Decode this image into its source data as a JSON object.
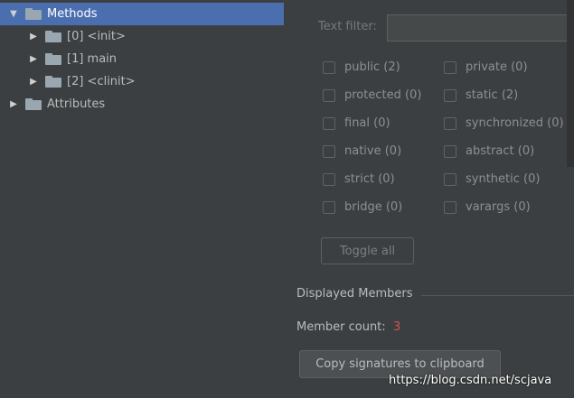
{
  "tree": {
    "items": [
      {
        "label": "Methods",
        "expanded": true,
        "selected": true,
        "level": 0
      },
      {
        "label": "[0] <init>",
        "expanded": false,
        "selected": false,
        "level": 1
      },
      {
        "label": "[1] main",
        "expanded": false,
        "selected": false,
        "level": 1
      },
      {
        "label": "[2] <clinit>",
        "expanded": false,
        "selected": false,
        "level": 1
      },
      {
        "label": "Attributes",
        "expanded": false,
        "selected": false,
        "level": 0
      }
    ]
  },
  "filter": {
    "label": "Text filter:",
    "value": ""
  },
  "checkboxes": [
    {
      "label": "public (2)",
      "checked": false
    },
    {
      "label": "private (0)",
      "checked": false
    },
    {
      "label": "protected (0)",
      "checked": false
    },
    {
      "label": "static (2)",
      "checked": false
    },
    {
      "label": "final (0)",
      "checked": false
    },
    {
      "label": "synchronized (0)",
      "checked": false
    },
    {
      "label": "native (0)",
      "checked": false
    },
    {
      "label": "abstract (0)",
      "checked": false
    },
    {
      "label": "strict (0)",
      "checked": false
    },
    {
      "label": "synthetic (0)",
      "checked": false
    },
    {
      "label": "bridge (0)",
      "checked": false
    },
    {
      "label": "varargs (0)",
      "checked": false
    }
  ],
  "toggle_all_label": "Toggle all",
  "displayed_members": {
    "title": "Displayed Members",
    "count_label": "Member count:",
    "count_value": "3"
  },
  "copy_button_label": "Copy signatures to clipboard",
  "watermark": "https://blog.csdn.net/scjava",
  "colors": {
    "background": "#3c3f41",
    "selection": "#4b6eaf",
    "count_value": "#d25252"
  }
}
